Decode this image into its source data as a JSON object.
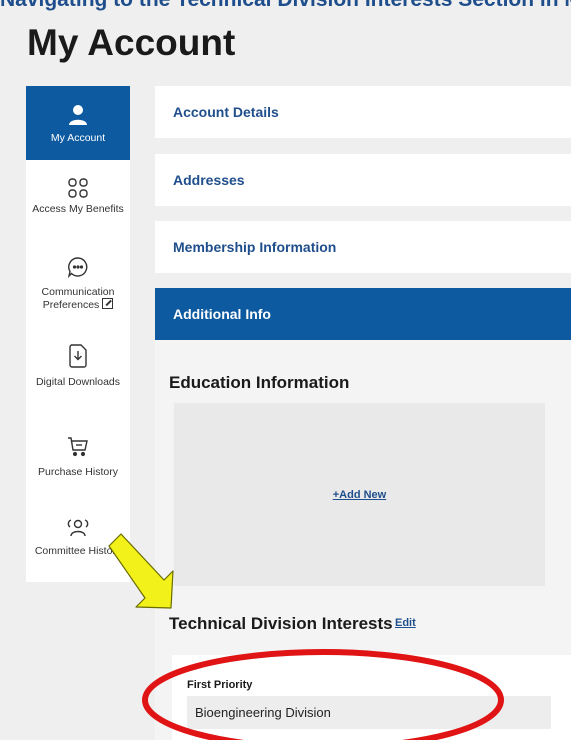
{
  "banner": {
    "text": "Navigating to the Technical Division Interests Section in My Account"
  },
  "page": {
    "title": "My Account"
  },
  "sidebar": {
    "items": [
      {
        "label": "My Account",
        "icon": "user-icon",
        "active": true
      },
      {
        "label": "Access My Benefits",
        "icon": "grid-icon"
      },
      {
        "label": "Communication Preferences",
        "icon": "chat-bubble-icon",
        "external": true
      },
      {
        "label": "Digital Downloads",
        "icon": "download-icon"
      },
      {
        "label": "Purchase History",
        "icon": "cart-icon"
      },
      {
        "label": "Committee History",
        "icon": "people-icon"
      }
    ]
  },
  "panels": {
    "account_details": "Account Details",
    "addresses": "Addresses",
    "membership": "Membership Information",
    "additional": "Additional Info"
  },
  "education": {
    "heading": "Education Information",
    "add_link": "+Add New"
  },
  "technical": {
    "heading": "Technical Division Interests",
    "edit_link": "Edit",
    "first_priority_label": "First Priority",
    "first_priority_value": "Bioengineering Division"
  },
  "annotations": {
    "arrow_color": "#f2f21a",
    "ellipse_color": "#e01414"
  },
  "colors": {
    "brand_blue": "#0d5aa0",
    "link_blue": "#1f4e8c"
  }
}
